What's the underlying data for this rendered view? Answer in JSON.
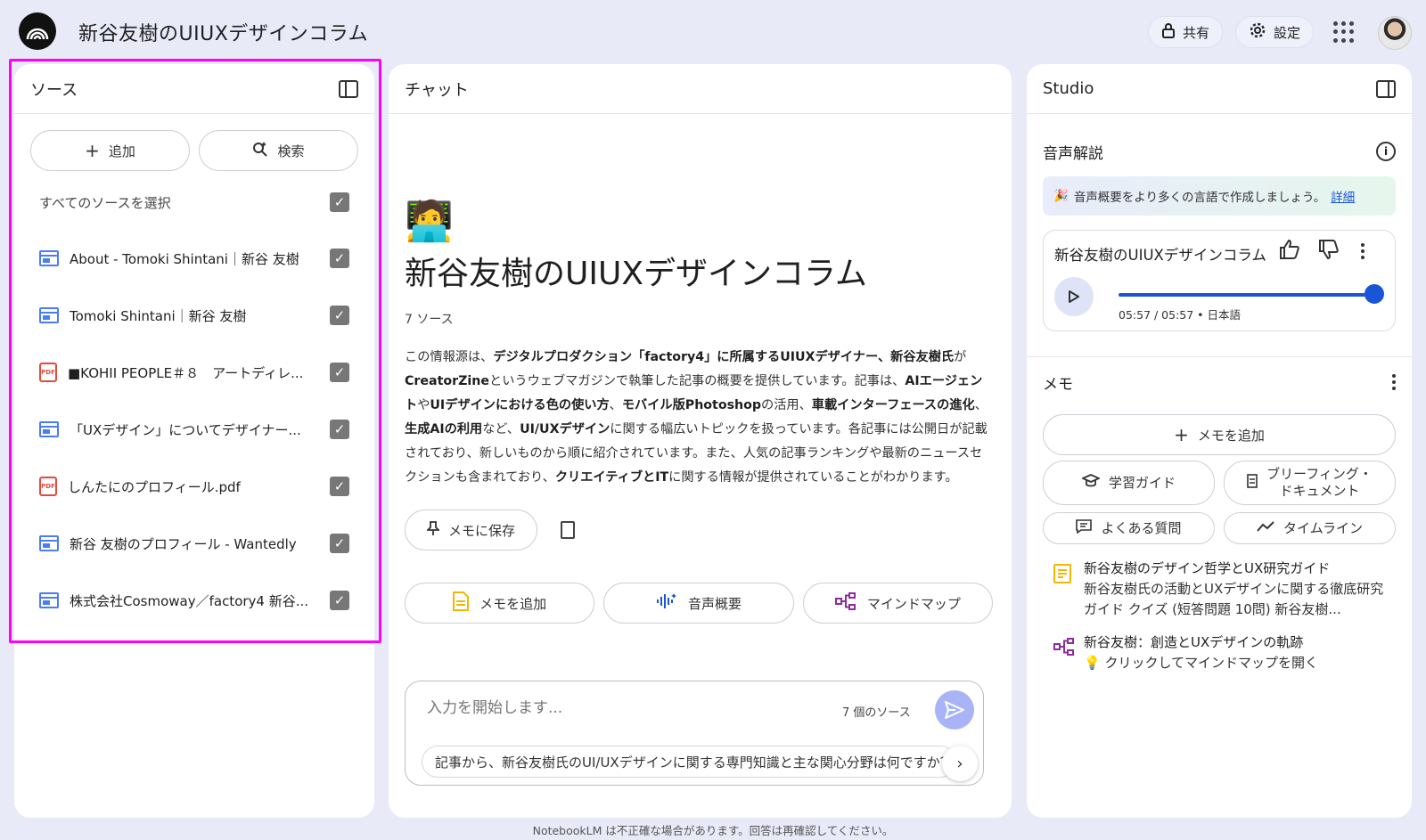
{
  "app": {
    "notebook_title": "新谷友樹のUIUXデザインコラム",
    "share_label": "共有",
    "settings_label": "設定"
  },
  "sources": {
    "header": "ソース",
    "add_label": "追加",
    "search_label": "検索",
    "select_all_label": "すべてのソースを選択",
    "items": [
      {
        "label": "About - Tomoki Shintani｜新谷 友樹",
        "type": "web",
        "checked": true
      },
      {
        "label": "Tomoki Shintani｜新谷 友樹",
        "type": "web",
        "checked": true
      },
      {
        "label": "■KOHII PEOPLE＃８　アートディレ...",
        "type": "pdf",
        "checked": true
      },
      {
        "label": "「UXデザイン」についてデザイナー...",
        "type": "web",
        "checked": true
      },
      {
        "label": "しんたにのプロフィール.pdf",
        "type": "pdf",
        "checked": true
      },
      {
        "label": "新谷 友樹のプロフィール - Wantedly",
        "type": "web",
        "checked": true
      },
      {
        "label": "株式会社Cosmoway／factory4 新谷...",
        "type": "web",
        "checked": true
      }
    ]
  },
  "chat": {
    "header": "チャット",
    "emoji": "🧑‍💻",
    "title": "新谷友樹のUIUXデザインコラム",
    "source_count": "7 ソース",
    "summary_parts": [
      {
        "t": "この情報源は、",
        "b": false
      },
      {
        "t": "デジタルプロダクション「factory4」に所属するUIUXデザイナー、新谷友樹氏",
        "b": true
      },
      {
        "t": "が",
        "b": false
      },
      {
        "t": "CreatorZine",
        "b": true
      },
      {
        "t": "というウェブマガジンで執筆した記事の概要を提供しています。記事は、",
        "b": false
      },
      {
        "t": "AIエージェント",
        "b": true
      },
      {
        "t": "や",
        "b": false
      },
      {
        "t": "UIデザインにおける色の使い方",
        "b": true
      },
      {
        "t": "、",
        "b": false
      },
      {
        "t": "モバイル版Photoshop",
        "b": true
      },
      {
        "t": "の活用、",
        "b": false
      },
      {
        "t": "車載インターフェースの進化",
        "b": true
      },
      {
        "t": "、",
        "b": false
      },
      {
        "t": "生成AIの利用",
        "b": true
      },
      {
        "t": "など、",
        "b": false
      },
      {
        "t": "UI/UXデザイン",
        "b": true
      },
      {
        "t": "に関する幅広いトピックを扱っています。各記事には公開日が記載されており、新しいものから順に紹介されています。また、人気の記事ランキングや最新のニュースセクションも含まれており、",
        "b": false
      },
      {
        "t": "クリエイティブとIT",
        "b": true
      },
      {
        "t": "に関する情報が提供されていることがわかります。",
        "b": false
      }
    ],
    "save_to_memo": "メモに保存",
    "actions": {
      "add_memo": "メモを追加",
      "audio_overview": "音声概要",
      "mind_map": "マインドマップ"
    },
    "input_placeholder": "入力を開始します...",
    "input_source_count": "7 個のソース",
    "suggestion": "記事から、新谷友樹氏のUI/UXデザインに関する専門知識と主な関心分野は何ですか？"
  },
  "studio": {
    "header": "Studio",
    "audio_section": "音声解説",
    "promo_text": "音声概要をより多くの言語で作成しましょう。",
    "promo_link": "詳細",
    "audio_title": "新谷友樹のUIUXデザインコラム",
    "audio_time": "05:57 / 05:57 • 日本語",
    "audio_progress": 1.0,
    "memo_section": "メモ",
    "add_memo": "メモを追加",
    "buttons": {
      "study_guide": "学習ガイド",
      "briefing_line1": "ブリーフィング・",
      "briefing_line2": "ドキュメント",
      "faq": "よくある質問",
      "timeline": "タイムライン"
    },
    "notes": [
      {
        "title": "新谷友樹のデザイン哲学とUX研究ガイド",
        "sub": "新谷友樹氏の活動とUXデザインに関する徹底研究ガイド クイズ (短答問題 10問) 新谷友樹...",
        "type": "study-guide"
      },
      {
        "title": "新谷友樹：創造とUXデザインの軌跡",
        "sub": "💡 クリックしてマインドマップを開く",
        "type": "mind-map"
      }
    ]
  },
  "footer": {
    "disclaimer": "NotebookLM は不正確な場合があります。回答は再確認してください。"
  },
  "colors": {
    "background": "#e9eaf7",
    "accent": "#1a55d8",
    "highlight": "#ff00ff",
    "web_icon": "#4a7ef0",
    "pdf_icon": "#e04b3b",
    "mind_map_icon": "#8e2c9c",
    "memo_icon": "#f2b705"
  }
}
